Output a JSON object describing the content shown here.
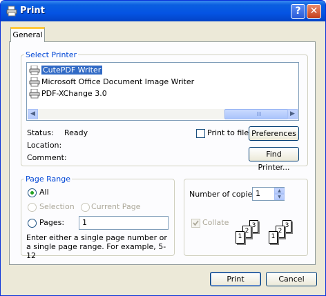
{
  "window": {
    "title": "Print"
  },
  "tabs": [
    {
      "label": "General"
    }
  ],
  "select_printer": {
    "legend": "Select Printer",
    "printers": [
      {
        "name": "CutePDF Writer",
        "selected": true
      },
      {
        "name": "Microsoft Office Document Image Writer",
        "selected": false
      },
      {
        "name": "PDF-XChange 3.0",
        "selected": false
      }
    ],
    "status_label": "Status:",
    "status_value": "Ready",
    "location_label": "Location:",
    "comment_label": "Comment:",
    "print_to_file_label": "Print to file",
    "preferences_label": "Preferences",
    "find_printer_label": "Find Printer..."
  },
  "page_range": {
    "legend": "Page Range",
    "all_label": "All",
    "selection_label": "Selection",
    "current_page_label": "Current Page",
    "pages_label": "Pages:",
    "pages_value": "1",
    "help_text": "Enter either a single page number or a single page range.  For example, 5-12"
  },
  "copies": {
    "label": "Number of copies:",
    "value": "1",
    "collate_label": "Collate",
    "collate_set1": [
      "1",
      "2",
      "3"
    ],
    "collate_set2": [
      "1",
      "2",
      "3"
    ]
  },
  "footer": {
    "print_label": "Print",
    "cancel_label": "Cancel"
  },
  "colors": {
    "title_bar": "#0554e3",
    "group_title": "#0046d5",
    "selection": "#316ac5",
    "dialog_bg": "#ece9d8"
  }
}
